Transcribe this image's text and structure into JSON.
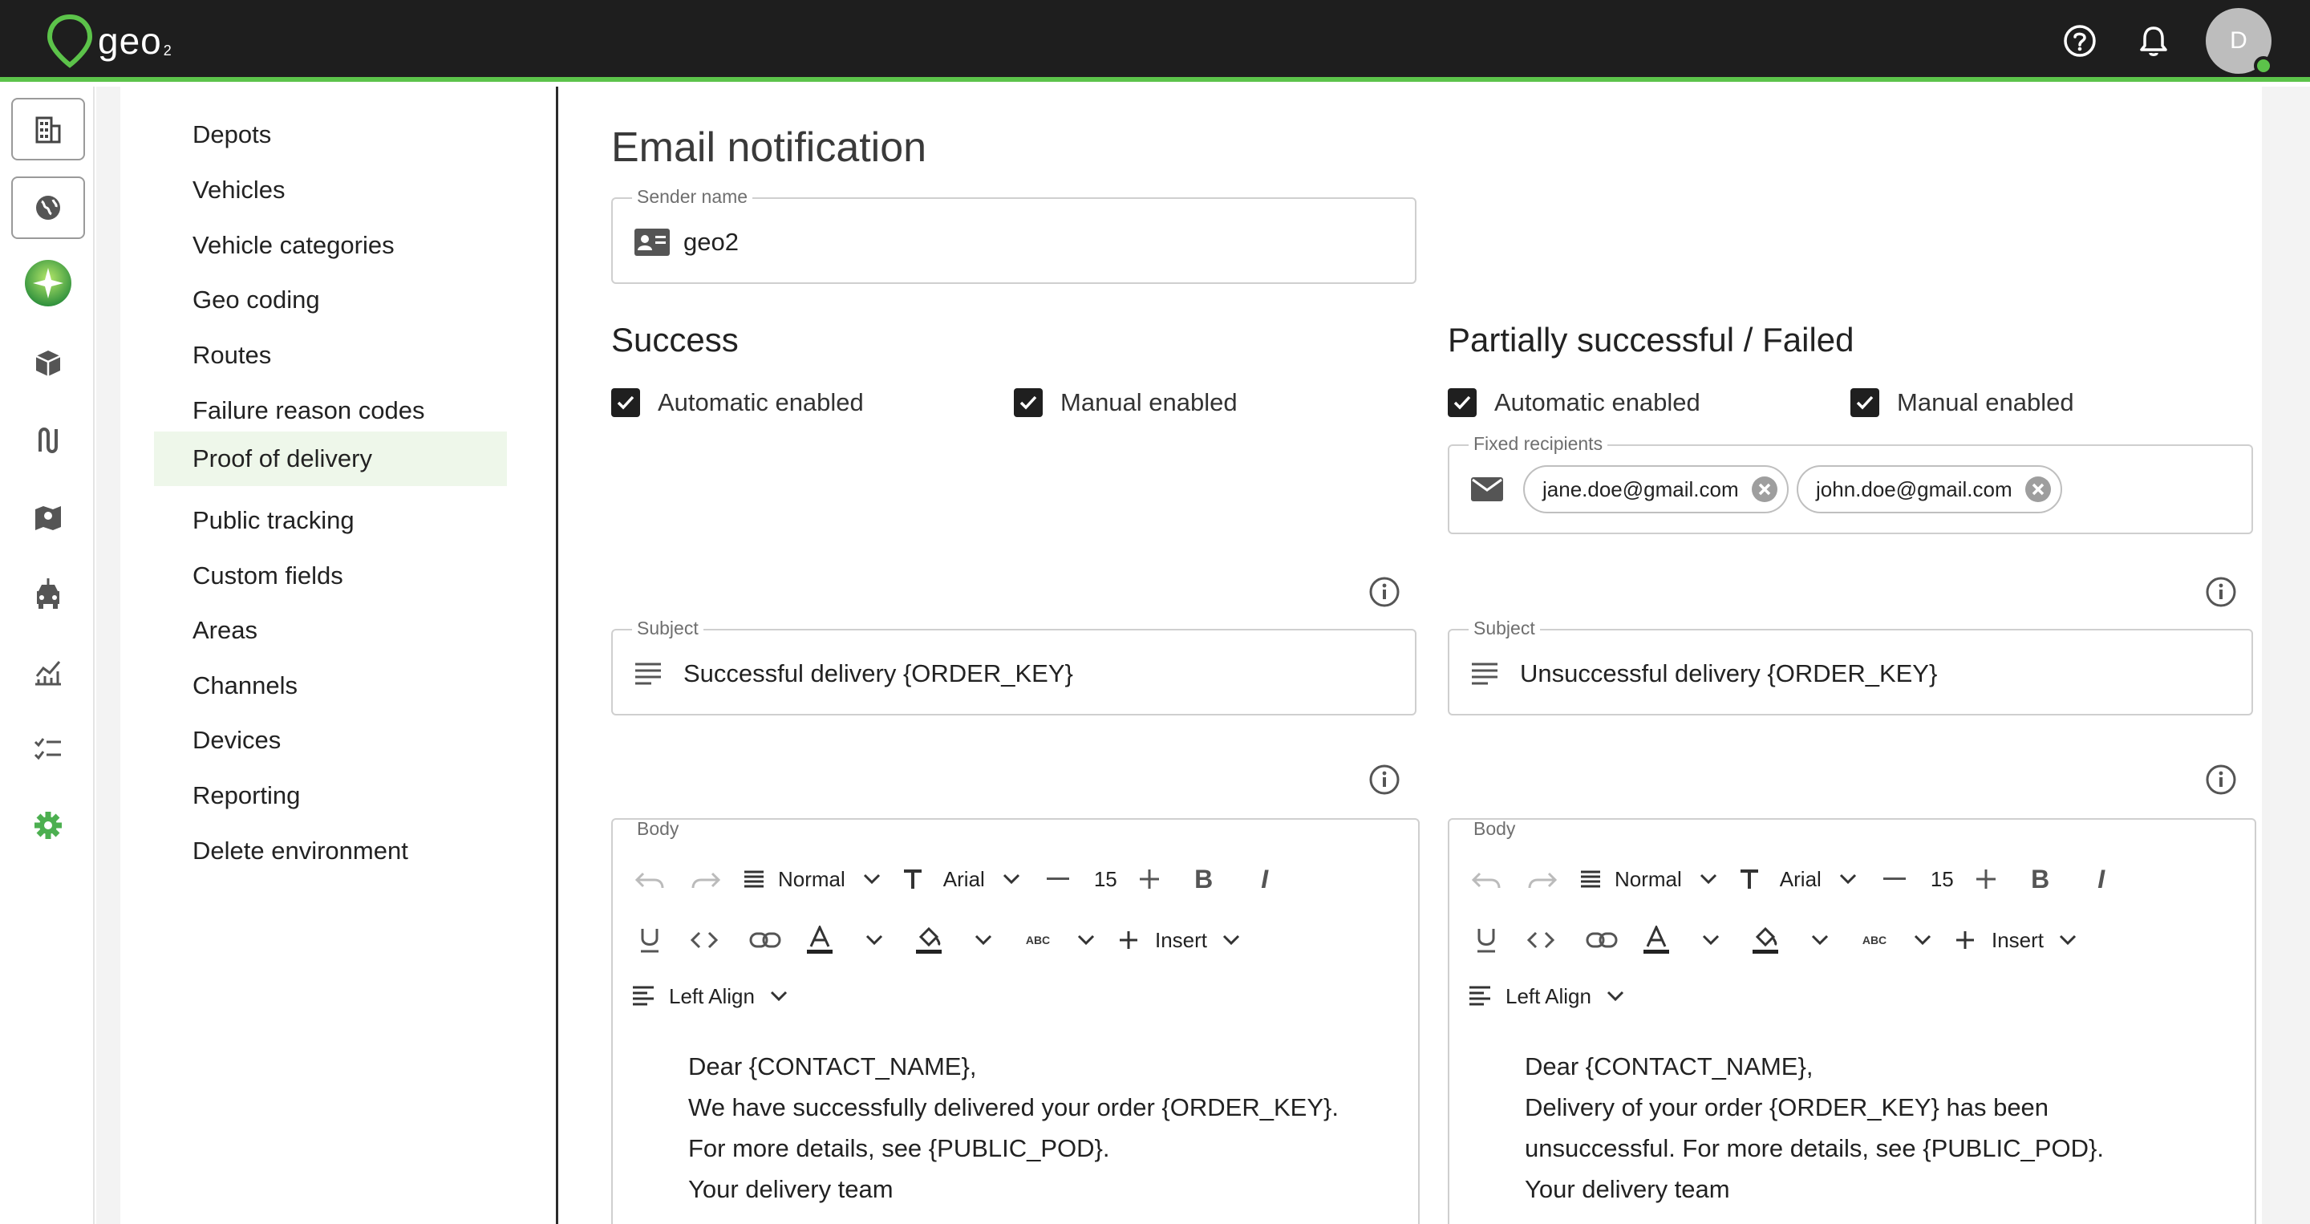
{
  "app": {
    "logo_text": "geo",
    "logo_sub": "2",
    "avatar_initial": "D",
    "accent_color": "#5cc34a"
  },
  "rail": {
    "items": [
      {
        "icon": "building-icon"
      },
      {
        "icon": "globe-icon"
      },
      {
        "icon": "sparkle-icon"
      },
      {
        "icon": "package-icon"
      },
      {
        "icon": "route-icon"
      },
      {
        "icon": "map-icon"
      },
      {
        "icon": "vehicle-icon"
      },
      {
        "icon": "analytics-icon"
      },
      {
        "icon": "checklist-icon"
      },
      {
        "icon": "gear-icon"
      }
    ]
  },
  "settings_nav": {
    "items": [
      {
        "label": "Depots"
      },
      {
        "label": "Vehicles"
      },
      {
        "label": "Vehicle categories"
      },
      {
        "label": "Geo coding"
      },
      {
        "label": "Routes"
      },
      {
        "label": "Failure reason codes"
      },
      {
        "label": "Proof of delivery"
      },
      {
        "label": "Public tracking"
      },
      {
        "label": "Custom fields"
      },
      {
        "label": "Areas"
      },
      {
        "label": "Channels"
      },
      {
        "label": "Devices"
      },
      {
        "label": "Reporting"
      },
      {
        "label": "Delete environment"
      }
    ],
    "active": "Proof of delivery"
  },
  "page": {
    "title": "Email notification",
    "sender": {
      "label": "Sender name",
      "value": "geo2"
    }
  },
  "success": {
    "title": "Success",
    "automatic_label": "Automatic enabled",
    "manual_label": "Manual enabled",
    "subject_label": "Subject",
    "subject_value": "Successful delivery {ORDER_KEY}",
    "body_label": "Body",
    "body_lines": [
      "Dear {CONTACT_NAME},",
      "We have successfully delivered your order {ORDER_KEY}.",
      "For more details, see {PUBLIC_POD}.",
      "Your delivery team"
    ]
  },
  "failed": {
    "title": "Partially successful / Failed",
    "automatic_label": "Automatic enabled",
    "manual_label": "Manual enabled",
    "recipients_label": "Fixed recipients",
    "recipients": [
      "jane.doe@gmail.com",
      "john.doe@gmail.com"
    ],
    "subject_label": "Subject",
    "subject_value": "Unsuccessful delivery {ORDER_KEY}",
    "body_label": "Body",
    "body_lines": [
      "Dear {CONTACT_NAME},",
      "Delivery of your order {ORDER_KEY} has been",
      "unsuccessful. For more details, see {PUBLIC_POD}.",
      "Your delivery team"
    ]
  },
  "toolbar": {
    "block_type": "Normal",
    "font_family": "Arial",
    "font_size": "15",
    "insert_label": "Insert",
    "align_label": "Left Align",
    "abc_label": "ABC"
  }
}
